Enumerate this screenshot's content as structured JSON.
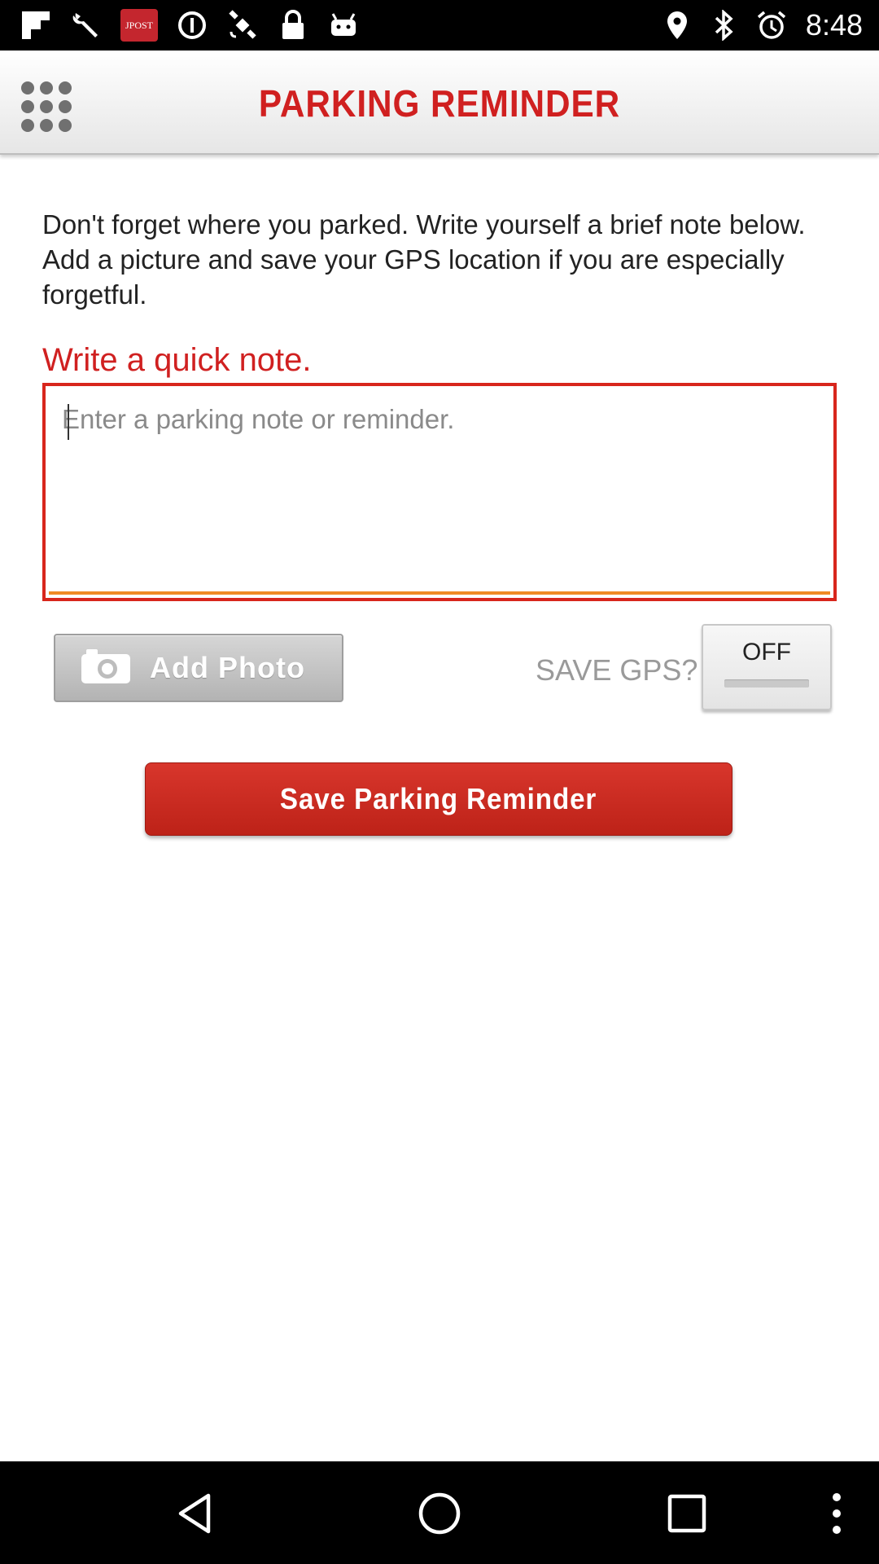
{
  "status_bar": {
    "time": "8:48",
    "left_icons": [
      "flipboard-icon",
      "wrench-icon",
      "ipost-app-icon",
      "data-saver-icon",
      "gps-satellite-icon",
      "lock-icon",
      "android-icon"
    ],
    "right_icons": [
      "location-icon",
      "bluetooth-icon",
      "alarm-icon"
    ],
    "ipost_label": "JPOST"
  },
  "header": {
    "title": "PARKING REMINDER",
    "menu_icon": "grid-menu-icon"
  },
  "intro_text": "Don't forget where you parked. Write yourself a brief note below. Add a picture and save your GPS location if you are especially forgetful.",
  "note": {
    "heading": "Write a quick note.",
    "placeholder": "Enter a parking note or reminder.",
    "value": ""
  },
  "photo_button": {
    "label": "Add Photo",
    "icon": "camera-icon"
  },
  "gps": {
    "label": "SAVE GPS?",
    "toggle_state": "OFF"
  },
  "save_button": {
    "label": "Save Parking Reminder"
  },
  "nav_bar": {
    "items": [
      "back-icon",
      "home-icon",
      "recents-icon",
      "overflow-menu-icon"
    ]
  },
  "colors": {
    "accent_red": "#d02020",
    "note_underline": "#f08a24",
    "button_red": "#c8281e"
  }
}
